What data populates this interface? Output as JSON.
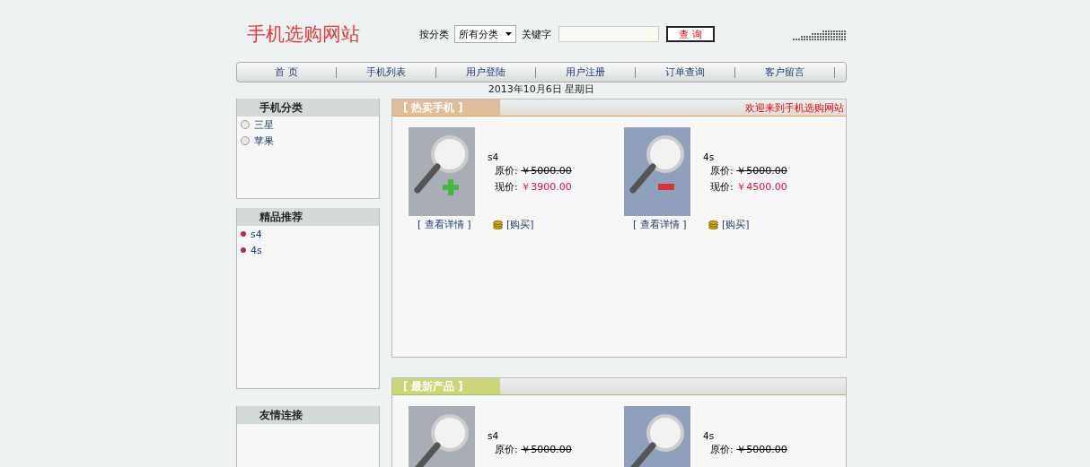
{
  "header": {
    "title": "手机选购网站",
    "category_label": "按分类",
    "category_value": "所有分类",
    "keyword_label": "关键字",
    "search_button": "查 询"
  },
  "nav": [
    {
      "label": "首 页"
    },
    {
      "label": "手机列表"
    },
    {
      "label": "用户登陆"
    },
    {
      "label": "用户注册"
    },
    {
      "label": "订单查询"
    },
    {
      "label": "客户留言"
    }
  ],
  "date": "2013年10月6日  星期日",
  "sidebar": [
    {
      "title": "手机分类",
      "kind": "radio",
      "items": [
        {
          "label": "三星",
          "selected": false
        },
        {
          "label": "苹果",
          "selected": false
        }
      ]
    },
    {
      "title": "精品推荐",
      "kind": "bullet",
      "items": [
        {
          "label": "s4"
        },
        {
          "label": "4s"
        }
      ]
    },
    {
      "title": "友情连接"
    }
  ],
  "hot": {
    "title": "[ 热卖手机 ]",
    "welcome": "欢迎来到手机选购网站",
    "products": [
      {
        "name": "s4",
        "orig_label": "原价:",
        "orig_price": "￥5000.00",
        "now_label": "现价:",
        "now_price": "￥3900.00",
        "detail": "[ 查看详情 ]",
        "buy": "[购买]"
      },
      {
        "name": "4s",
        "orig_label": "原价:",
        "orig_price": "￥5000.00",
        "now_label": "现价:",
        "now_price": "￥4500.00",
        "detail": "[ 查看详情 ]",
        "buy": "[购买]"
      }
    ]
  },
  "latest": {
    "title": "[ 最新产品 ]",
    "products": [
      {
        "name": "s4",
        "orig_label": "原价:",
        "orig_price": "￥5000.00"
      },
      {
        "name": "4s",
        "orig_label": "原价:",
        "orig_price": "￥5000.00"
      }
    ]
  }
}
